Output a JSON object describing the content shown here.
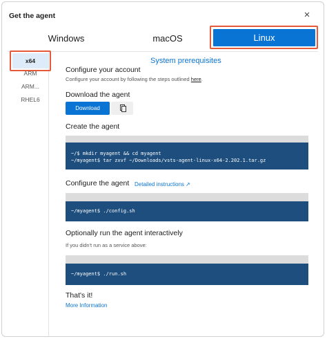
{
  "dialog": {
    "title": "Get the agent",
    "close_glyph": "×"
  },
  "tabs": [
    {
      "label": "Windows",
      "selected": false
    },
    {
      "label": "macOS",
      "selected": false
    },
    {
      "label": "Linux",
      "selected": true
    }
  ],
  "architectures": [
    {
      "label": "x64",
      "selected": true
    },
    {
      "label": "ARM",
      "selected": false
    },
    {
      "label": "ARM...",
      "selected": false
    },
    {
      "label": "RHEL6",
      "selected": false
    }
  ],
  "content": {
    "prereq_link": "System prerequisites",
    "configure_account": {
      "heading": "Configure your account",
      "text": "Configure your account by following the steps outlined ",
      "link": "here",
      "suffix": "."
    },
    "download": {
      "heading": "Download the agent",
      "button_label": "Download",
      "copy_icon": "copy-icon"
    },
    "create": {
      "heading": "Create the agent",
      "lines": [
        "~/$ mkdir myagent && cd myagent",
        "~/myagent$ tar zxvf ~/Downloads/vsts-agent-linux-x64-2.202.1.tar.gz"
      ]
    },
    "configure_agent": {
      "heading": "Configure the agent",
      "link": "Detailed instructions",
      "link_icon": "external-link-icon",
      "lines": [
        "~/myagent$ ./config.sh"
      ]
    },
    "run": {
      "heading": "Optionally run the agent interactively",
      "text": "If you didn't run as a service above:",
      "lines": [
        "~/myagent$ ./run.sh"
      ]
    },
    "done": {
      "heading": "That's it!",
      "link": "More Information"
    }
  },
  "colors": {
    "accent": "#0a74d4",
    "highlight": "#e4593a",
    "code_bg": "#1d4e7d",
    "selected_bg": "#deecf9"
  }
}
